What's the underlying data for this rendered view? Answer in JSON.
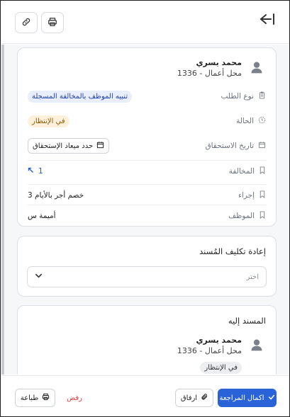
{
  "header": {
    "link_icon": "link-icon",
    "print_icon": "printer-icon",
    "collapse_icon": "collapse-right-icon"
  },
  "details": {
    "employee_name": "محمد يسري",
    "employee_store": "محل أعمال - 1336",
    "rows": [
      {
        "label": "نوع الطلب",
        "icon": "clipboard-icon",
        "value": "تنبيه الموظف بالمخالفة المسجلة"
      },
      {
        "label": "الحالة",
        "icon": "clock-icon",
        "value": "في الإنتظار"
      },
      {
        "label": "تاريخ الاستحقاق",
        "icon": "calendar-icon",
        "value": "حدد ميعاد الإستحقاق"
      },
      {
        "label": "المخالفة",
        "icon": "bookmark-icon",
        "value": "1"
      },
      {
        "label": "إجراء",
        "icon": "bookmark-icon",
        "value": "خصم أجر بالأيام 3"
      },
      {
        "label": "الموظف",
        "icon": "bookmark-icon",
        "value": "أميمة س"
      }
    ]
  },
  "reassign": {
    "title": "إعادة تكليف المُسند",
    "placeholder": "اختر"
  },
  "assignee": {
    "title": "المسند إليه",
    "name": "محمد يسري",
    "store": "محل أعمال - 1336",
    "status": "في الإنتظار"
  },
  "footer": {
    "complete_label": "اكمال المراجعة",
    "attach_label": "ارفاق",
    "reject_label": "رفض",
    "print_label": "طباعة"
  },
  "colors": {
    "primary": "#2a63d8",
    "reject": "#d83a3a",
    "pending_bg": "#fdf1dc",
    "type_tag_bg": "#e8eefc"
  }
}
